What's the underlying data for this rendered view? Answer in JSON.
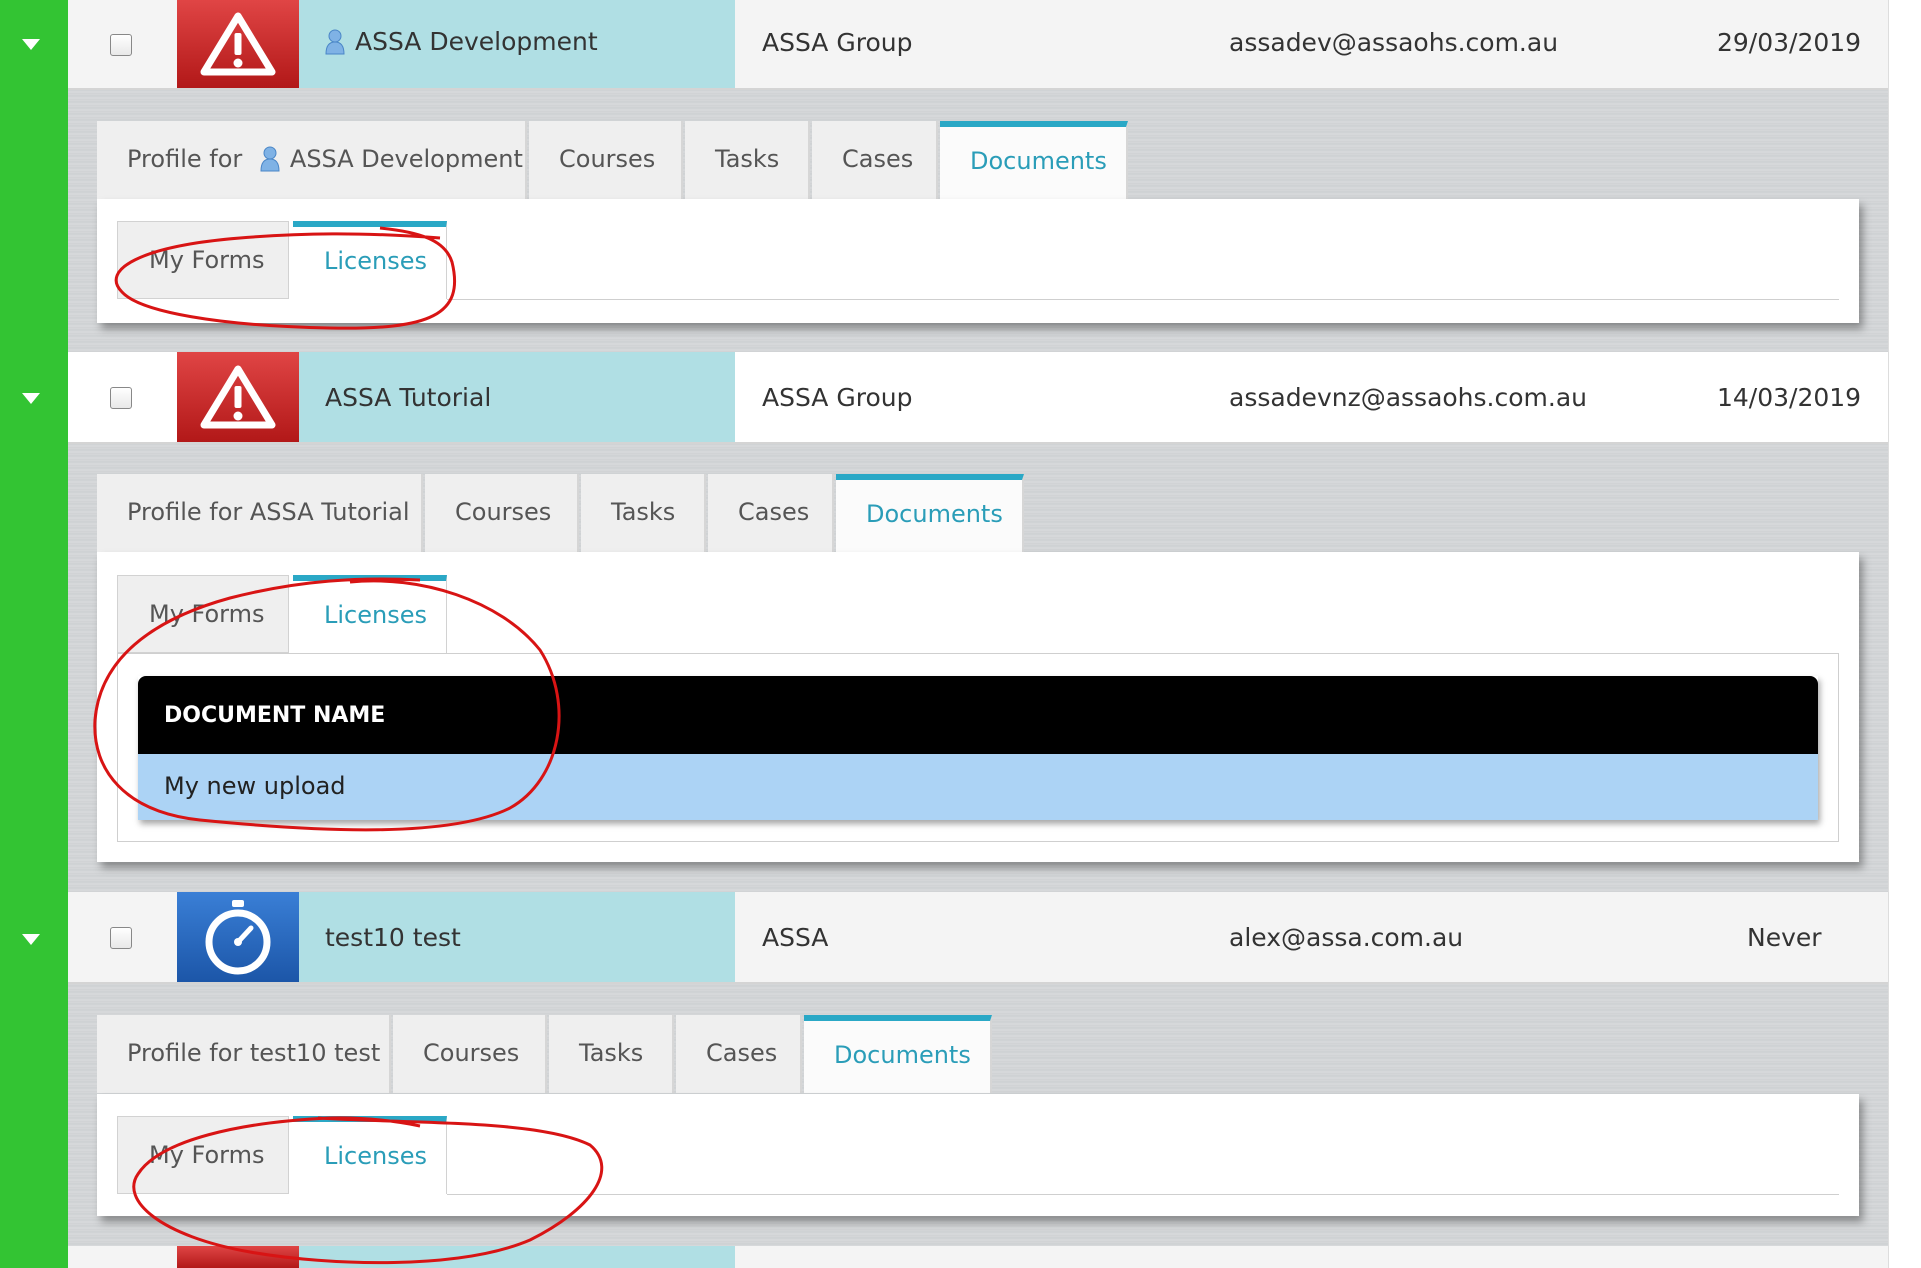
{
  "annotation_color": "#d81414",
  "records": [
    {
      "name": "ASSA Development",
      "status_icon": "warning-triangle-icon",
      "has_user_glyph": true,
      "group": "ASSA Group",
      "email": "assadev@assaohs.com.au",
      "date": "29/03/2019",
      "tabs": {
        "profile_prefix": "Profile for",
        "profile_name": "ASSA Development",
        "courses": "Courses",
        "tasks": "Tasks",
        "cases": "Cases",
        "documents": "Documents"
      },
      "subtabs": {
        "my_forms": "My Forms",
        "licenses": "Licenses"
      }
    },
    {
      "name": "ASSA Tutorial",
      "status_icon": "warning-triangle-icon",
      "group": "ASSA Group",
      "email": "assadevnz@assaohs.com.au",
      "date": "14/03/2019",
      "tabs": {
        "profile": "Profile for ASSA Tutorial",
        "courses": "Courses",
        "tasks": "Tasks",
        "cases": "Cases",
        "documents": "Documents"
      },
      "subtabs": {
        "my_forms": "My Forms",
        "licenses": "Licenses"
      },
      "documents_table": {
        "header": "DOCUMENT NAME",
        "rows": [
          "My new upload"
        ]
      }
    },
    {
      "name": "test10 test",
      "status_icon": "stopwatch-icon",
      "group": "ASSA",
      "email": "alex@assa.com.au",
      "date": "Never",
      "tabs": {
        "profile": "Profile for test10 test",
        "courses": "Courses",
        "tasks": "Tasks",
        "cases": "Cases",
        "documents": "Documents"
      },
      "subtabs": {
        "my_forms": "My Forms",
        "licenses": "Licenses"
      }
    }
  ]
}
